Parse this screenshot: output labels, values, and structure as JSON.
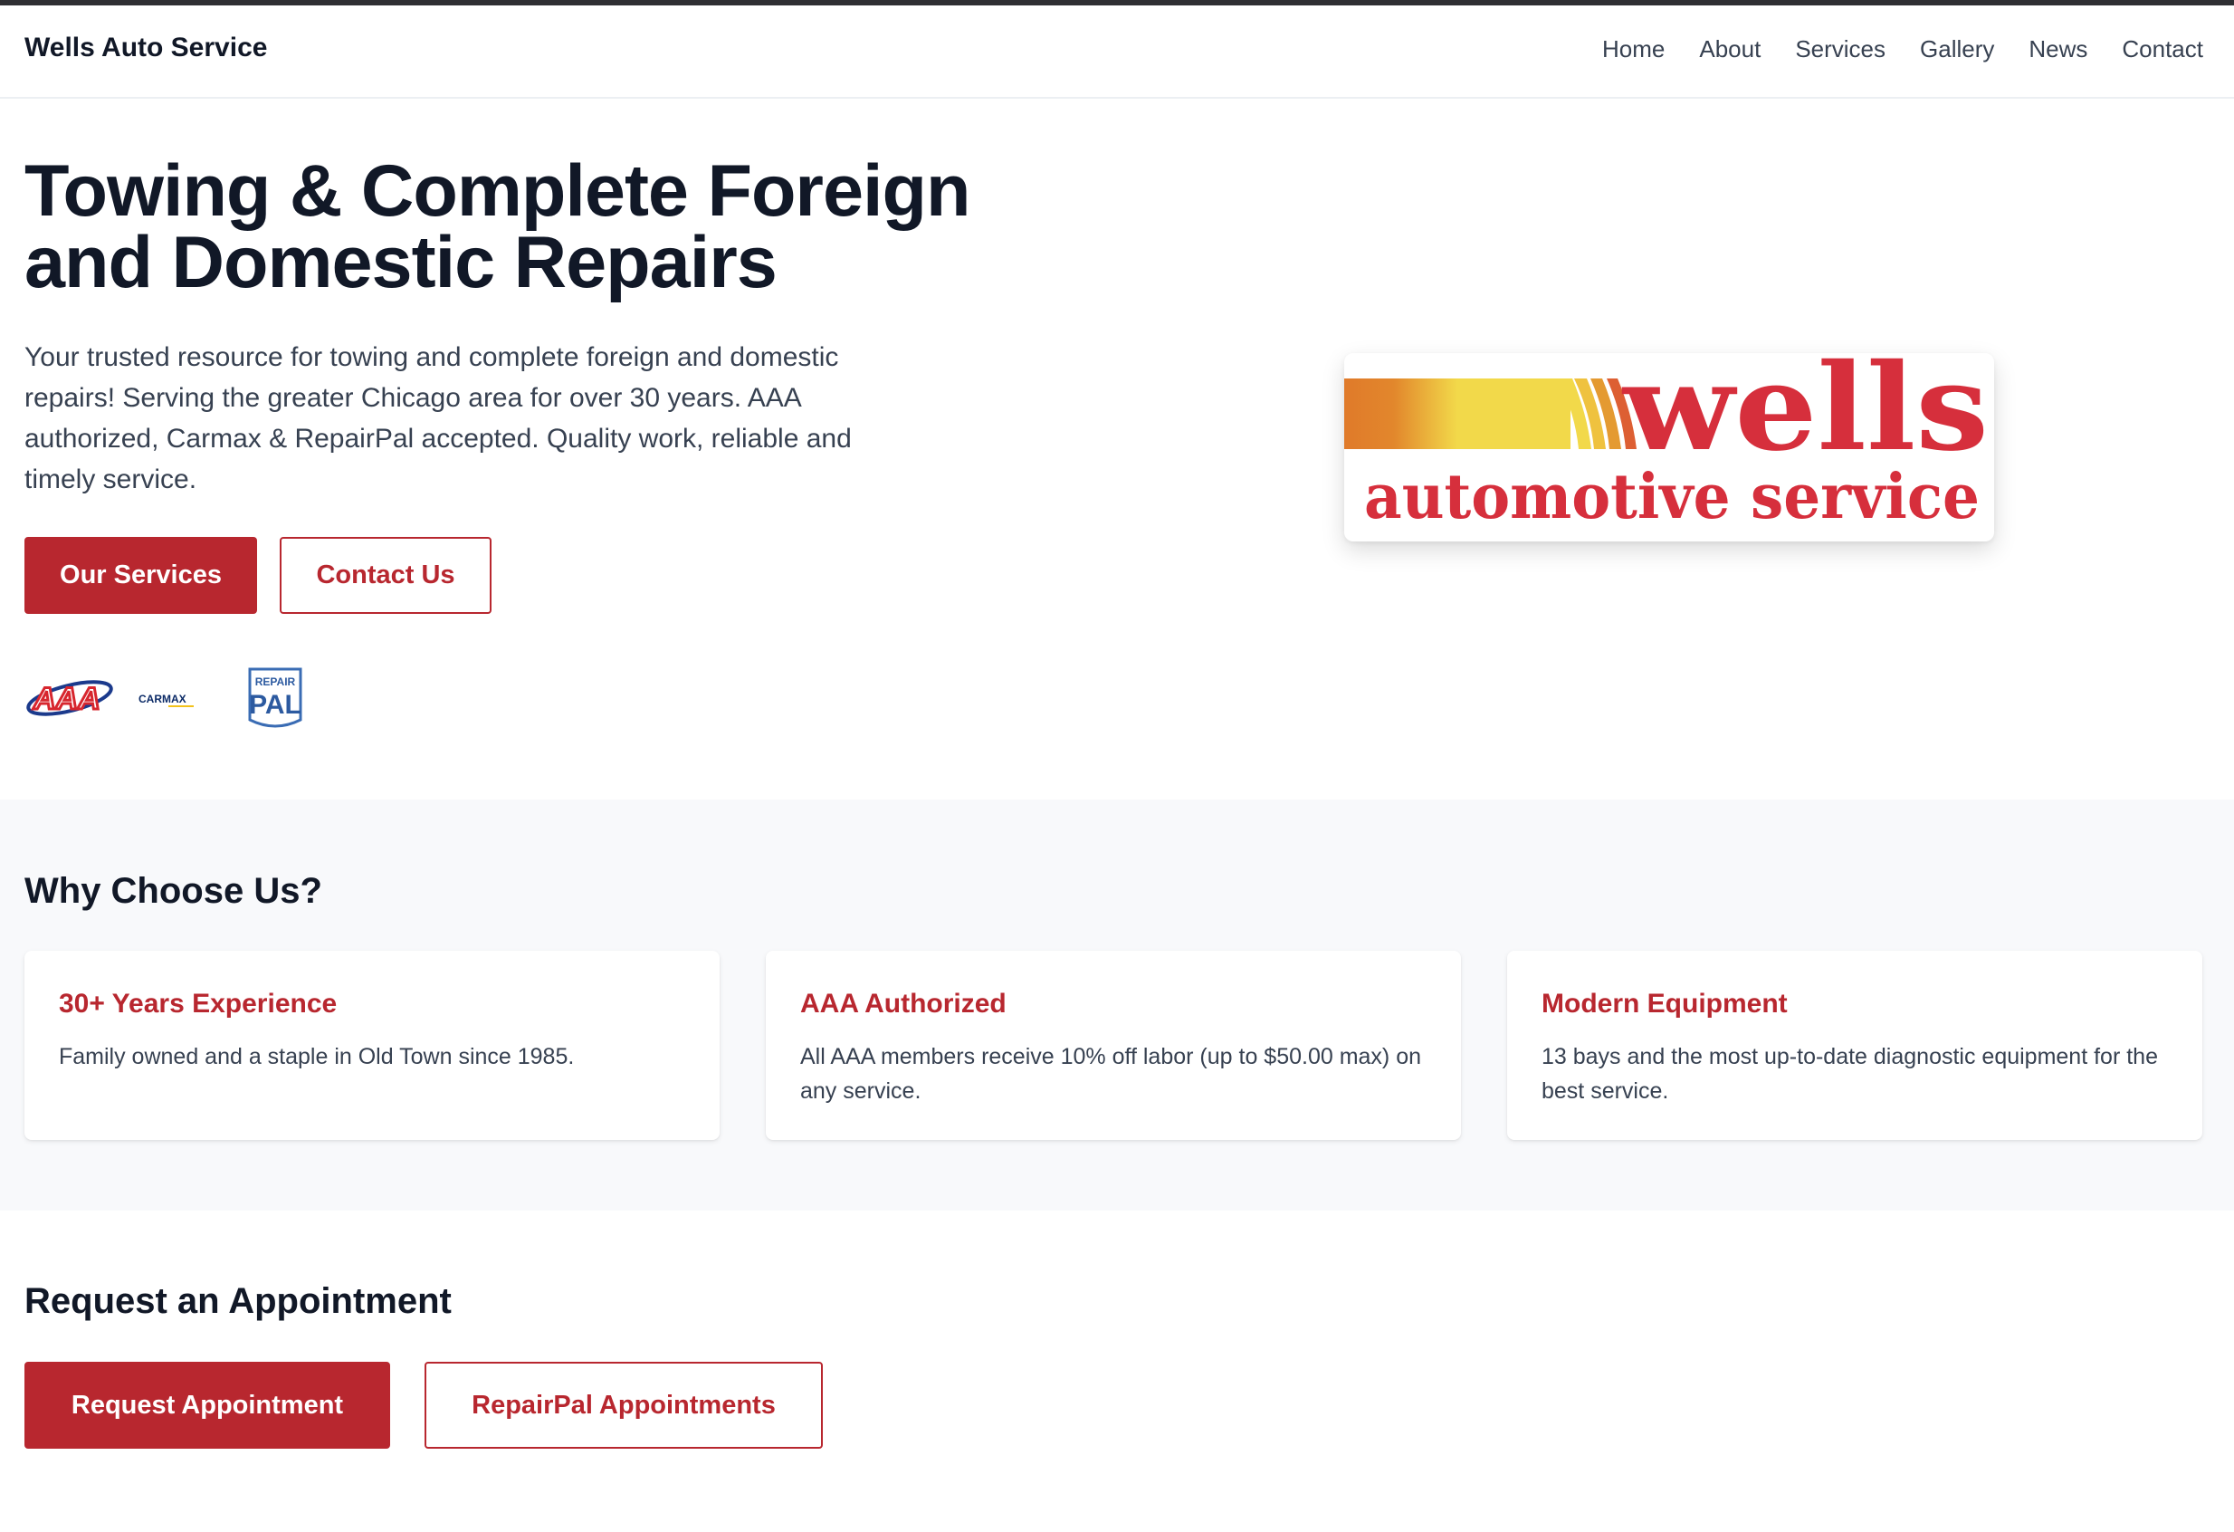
{
  "header": {
    "brand": "Wells Auto Service",
    "nav": [
      "Home",
      "About",
      "Services",
      "Gallery",
      "News",
      "Contact"
    ]
  },
  "hero": {
    "title": "Towing & Complete Foreign and Domestic Repairs",
    "description": "Your trusted resource for towing and complete foreign and domestic repairs! Serving the greater Chicago area for over 30 years. AAA authorized, Carmax & RepairPal accepted. Quality work, reliable and timely service.",
    "primary_button": "Our Services",
    "secondary_button": "Contact Us",
    "partner_logos": {
      "aaa": "AAA",
      "carmax": "CARMAX",
      "repairpal_top": "REPAIR",
      "repairpal_bottom": "PAL"
    },
    "logo": {
      "line1": "wells",
      "line2": "automotive service"
    }
  },
  "why": {
    "heading": "Why Choose Us?",
    "cards": [
      {
        "title": "30+ Years Experience",
        "text": "Family owned and a staple in Old Town since 1985."
      },
      {
        "title": "AAA Authorized",
        "text": "All AAA members receive 10% off labor (up to $50.00 max) on any service."
      },
      {
        "title": "Modern Equipment",
        "text": "13 bays and the most up-to-date diagnostic equipment for the best service."
      }
    ]
  },
  "appointment": {
    "heading": "Request an Appointment",
    "primary_button": "Request Appointment",
    "secondary_button": "RepairPal Appointments"
  },
  "colors": {
    "accent": "#b8272f",
    "heading": "#111827",
    "body_text": "#374151",
    "section_bg": "#f8f9fb",
    "logo_red": "#d62f3c",
    "logo_yellow": "#f2d94a",
    "logo_orange": "#e07a2a"
  }
}
